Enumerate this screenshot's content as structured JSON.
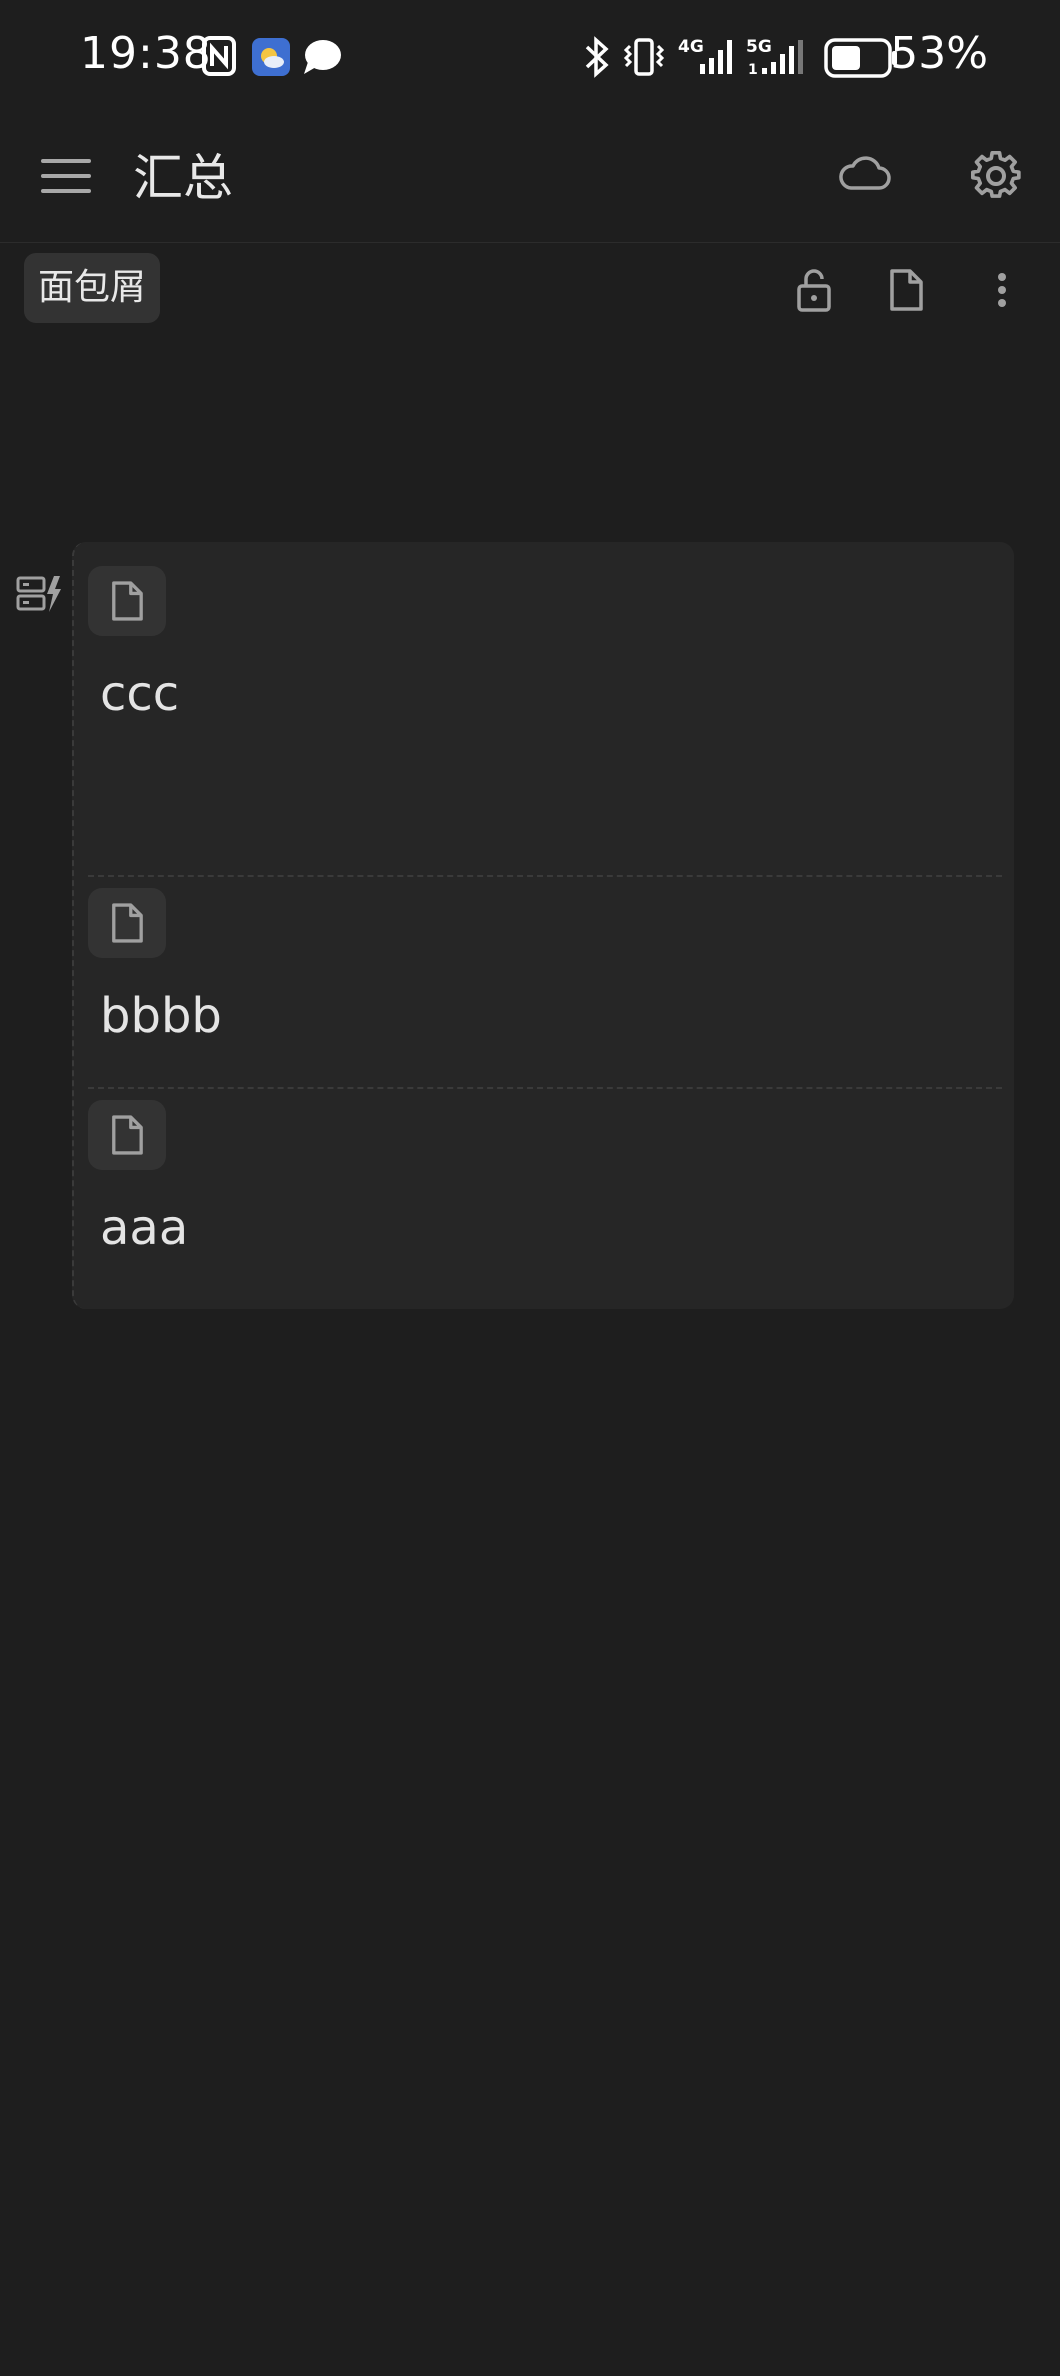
{
  "status_bar": {
    "time": "19:38",
    "battery_percent": "53%",
    "network_4g": "4G",
    "network_5g": "5G",
    "battery_level": 0.53
  },
  "app_bar": {
    "title": "汇总",
    "menu_icon": "menu-icon",
    "cloud_icon": "cloud-icon",
    "settings_icon": "gear-icon"
  },
  "toolbar": {
    "breadcrumb_label": "面包屑",
    "unlock_icon": "unlock-icon",
    "document_icon": "document-icon",
    "more_icon": "more-vertical-icon"
  },
  "document": {
    "blocks": [
      {
        "title": "ccc",
        "icon": "document-icon"
      },
      {
        "title": "bbbb",
        "icon": "document-icon"
      },
      {
        "title": "aaa",
        "icon": "document-icon"
      }
    ]
  },
  "colors": {
    "background": "#1e1e1e",
    "card": "#262626",
    "chip": "#333333",
    "icon": "#a0a0a0"
  }
}
